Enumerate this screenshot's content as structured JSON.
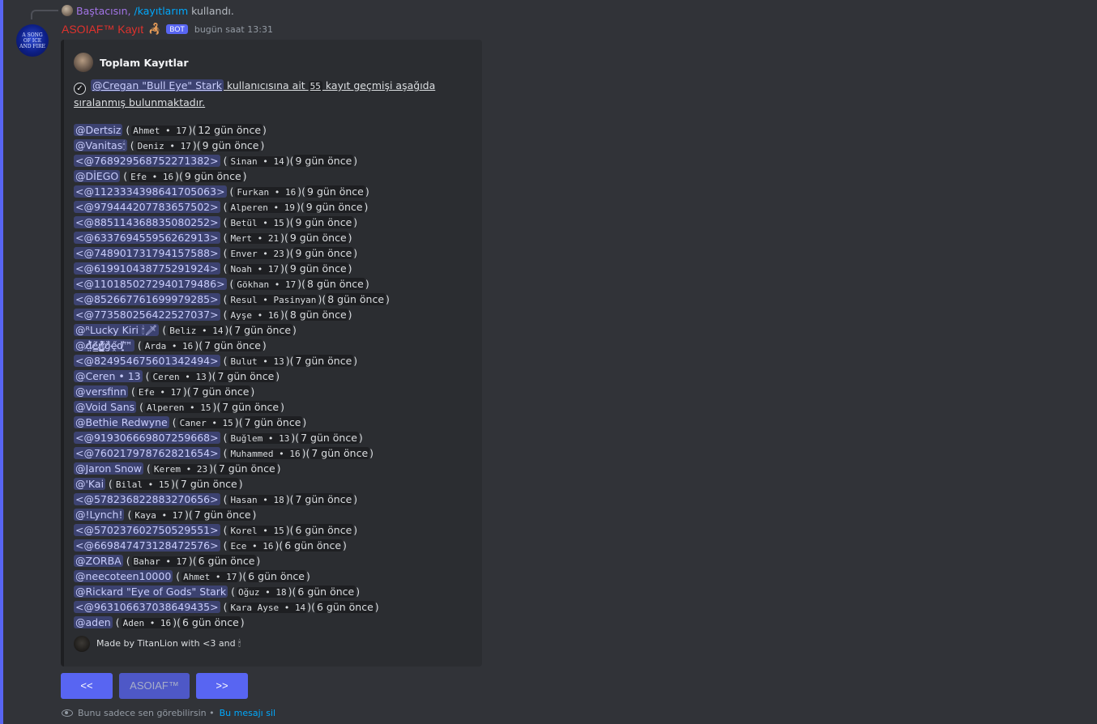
{
  "reply": {
    "user": "Baştacısın,",
    "command": "/kayıtlarım",
    "suffix": "kullandı."
  },
  "message": {
    "bot_name": "ASOIAF™ Kayıt",
    "bot_emoji": "🦂",
    "bot_tag": "BOT",
    "timestamp": "bugün saat 13:31",
    "avatar_text": "A SONG OF ICE AND FIRE"
  },
  "embed": {
    "author": "Toplam Kayıtlar",
    "desc": {
      "check": "✓",
      "mention": "@Cregan \"Bull Eye\" Stark",
      "text1": " kullanıcısına ait ",
      "count": "55",
      "text2": " kayıt geçmişi aşağıda sıralanmış bulunmaktadır."
    },
    "records": [
      {
        "user": "@Dertsiz",
        "info": "Ahmet • 17",
        "time": "12 gün önce"
      },
      {
        "user": "@Vanitas🕯",
        "info": "Deniz • 17",
        "time": "9 gün önce"
      },
      {
        "user": "<@768929568752271382>",
        "info": "Sinan • 14",
        "time": "9 gün önce"
      },
      {
        "user": "@DİEGO",
        "info": "Efe • 16",
        "time": "9 gün önce"
      },
      {
        "user": "<@1123334398641705063>",
        "info": "Furkan • 16",
        "time": "9 gün önce"
      },
      {
        "user": "<@979444207783657502>",
        "info": "Alperen • 19",
        "time": "9 gün önce"
      },
      {
        "user": "<@885114368835080252>",
        "info": "Betül • 15",
        "time": "9 gün önce"
      },
      {
        "user": "<@633769455956262913>",
        "info": "Mert • 21",
        "time": "9 gün önce"
      },
      {
        "user": "<@748901731794157588>",
        "info": "Enver • 23",
        "time": "9 gün önce"
      },
      {
        "user": "<@619910438775291924>",
        "info": "Noah • 17",
        "time": "9 gün önce"
      },
      {
        "user": "<@1101850272940179486>",
        "info": "Gökhan • 17",
        "time": "8 gün önce"
      },
      {
        "user": "<@852667761699979285>",
        "info": "Resul • Pasinyan",
        "time": "8 gün önce"
      },
      {
        "user": "<@773580256422527037>",
        "info": "Ayşe • 16",
        "time": "8 gün önce"
      },
      {
        "user": "@ᴿLucky Kiri 🕯🗡",
        "info": "Beliz • 14",
        "time": "7 gün önce"
      },
      {
        "user": "@đ̸̤̓ẽ̸̳ṟ̸̛̭̤͖̐ĭ̸̛͍̳̰̑ğ̸̣̍ḙ̶̋d̸͍͔̏™",
        "info": "Arda • 16",
        "time": "7 gün önce"
      },
      {
        "user": "<@824954675601342494>",
        "info": "Bulut • 13",
        "time": "7 gün önce"
      },
      {
        "user": "@Ceren • 13",
        "info": "Ceren • 13",
        "time": "7 gün önce"
      },
      {
        "user": "@versfinn",
        "info": "Efe • 17",
        "time": "7 gün önce"
      },
      {
        "user": "@Void Sans",
        "info": "Alperen • 15",
        "time": "7 gün önce"
      },
      {
        "user": "@Bethie Redwyne",
        "info": "Caner • 15",
        "time": "7 gün önce"
      },
      {
        "user": "<@919306669807259668>",
        "info": "Buğlem • 13",
        "time": "7 gün önce"
      },
      {
        "user": "<@760217978762821654>",
        "info": "Muhammed • 16",
        "time": "7 gün önce"
      },
      {
        "user": "@Jaron Snow",
        "info": "Kerem • 23",
        "time": "7 gün önce"
      },
      {
        "user": "@'Kai",
        "info": "Bilal • 15",
        "time": "7 gün önce"
      },
      {
        "user": "<@578236822883270656>",
        "info": "Hasan • 18",
        "time": "7 gün önce"
      },
      {
        "user": "@!Lynch!",
        "info": "Kaya • 17",
        "time": "7 gün önce"
      },
      {
        "user": "<@570237602750529551>",
        "info": "Korel • 15",
        "time": "6 gün önce"
      },
      {
        "user": "<@669847473128472576>",
        "info": "Ece • 16",
        "time": "6 gün önce"
      },
      {
        "user": "@ZORBA",
        "info": "Bahar • 17",
        "time": "6 gün önce"
      },
      {
        "user": "@neecoteen10000",
        "info": "Ahmet • 17",
        "time": "6 gün önce"
      },
      {
        "user": "@Rickard \"Eye of Gods\" Stark",
        "info": "Oğuz • 18",
        "time": "6 gün önce"
      },
      {
        "user": "<@963106637038649435>",
        "info": "Kara Ayse • 14",
        "time": "6 gün önce"
      },
      {
        "user": "@aden",
        "info": "Aden • 16",
        "time": "6 gün önce"
      }
    ],
    "footer": "Made by TitanLion with <3 and 🕯"
  },
  "buttons": {
    "prev": "<<",
    "middle": "ASOIAF™",
    "next": ">>"
  },
  "ephemeral": {
    "text": "Bunu sadece sen görebilirsin •",
    "dismiss": "Bu mesajı sil"
  }
}
